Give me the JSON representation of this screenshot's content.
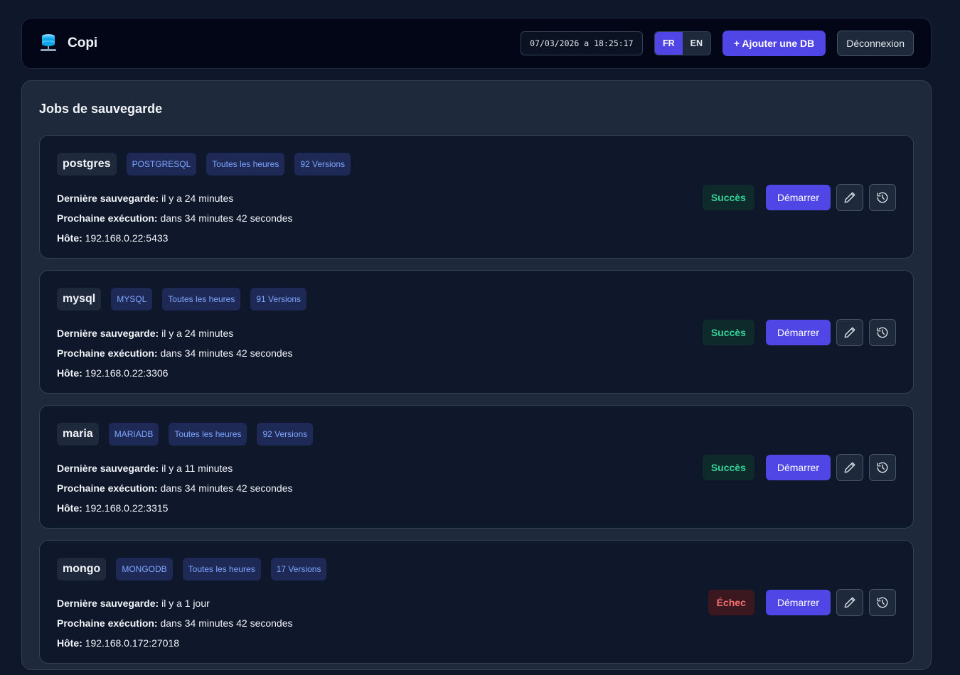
{
  "header": {
    "app_name": "Copi",
    "datetime": "07/03/2026 a 18:25:17",
    "lang_fr": "FR",
    "lang_en": "EN",
    "add_db_label": "+ Ajouter une DB",
    "logout_label": "Déconnexion"
  },
  "panel": {
    "title": "Jobs de sauvegarde"
  },
  "labels": {
    "last_backup": "Dernière sauvegarde:",
    "next_run": "Prochaine exécution:",
    "host": "Hôte:",
    "start": "Démarrer"
  },
  "jobs": [
    {
      "name": "postgres",
      "engine": "POSTGRESQL",
      "schedule": "Toutes les heures",
      "versions": "92 Versions",
      "last_backup": "il y a 24 minutes",
      "next_run": "dans 34 minutes 42 secondes",
      "host": "192.168.0.22:5433",
      "status": "Succès",
      "status_type": "ok"
    },
    {
      "name": "mysql",
      "engine": "MYSQL",
      "schedule": "Toutes les heures",
      "versions": "91 Versions",
      "last_backup": "il y a 24 minutes",
      "next_run": "dans 34 minutes 42 secondes",
      "host": "192.168.0.22:3306",
      "status": "Succès",
      "status_type": "ok"
    },
    {
      "name": "maria",
      "engine": "MARIADB",
      "schedule": "Toutes les heures",
      "versions": "92 Versions",
      "last_backup": "il y a 11 minutes",
      "next_run": "dans 34 minutes 42 secondes",
      "host": "192.168.0.22:3315",
      "status": "Succès",
      "status_type": "ok"
    },
    {
      "name": "mongo",
      "engine": "MONGODB",
      "schedule": "Toutes les heures",
      "versions": "17 Versions",
      "last_backup": "il y a 1 jour",
      "next_run": "dans 34 minutes 42 secondes",
      "host": "192.168.0.172:27018",
      "status": "Échec",
      "status_type": "fail"
    }
  ],
  "colors": {
    "accent": "#4f46e5",
    "success": "#34d399",
    "failure": "#f87171",
    "background": "#0f172a"
  },
  "icons": {
    "brand": "database-server-icon",
    "edit": "pencil-icon",
    "history": "history-icon"
  }
}
